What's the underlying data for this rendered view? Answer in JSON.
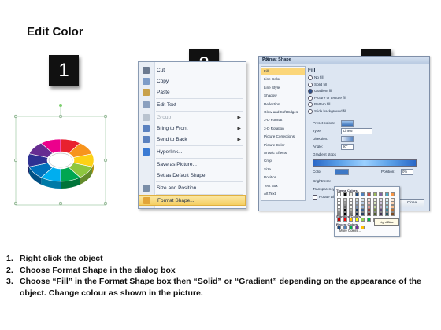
{
  "page": {
    "title": "Edit Color"
  },
  "badges": [
    "1",
    "2",
    "3"
  ],
  "context_menu": {
    "items": [
      {
        "label": "Cut",
        "icon": "scissors-icon",
        "color": "#6b7a90"
      },
      {
        "label": "Copy",
        "icon": "copy-icon",
        "color": "#7d9cc8"
      },
      {
        "label": "Paste",
        "icon": "paste-icon",
        "color": "#c8a14a"
      },
      {
        "label": "Edit Text",
        "icon": "edit-text-icon",
        "color": "#8aa0bf"
      },
      {
        "label": "Group",
        "icon": "group-icon",
        "color": "#b9c3cf",
        "disabled": true,
        "submenu": true
      },
      {
        "label": "Bring to Front",
        "icon": "bring-front-icon",
        "color": "#5b82c0",
        "submenu": true
      },
      {
        "label": "Send to Back",
        "icon": "send-back-icon",
        "color": "#5b82c0",
        "submenu": true
      },
      {
        "label": "Hyperlink...",
        "icon": "hyperlink-icon",
        "color": "#3b7bd4"
      },
      {
        "label": "Save as Picture...",
        "icon": "",
        "color": ""
      },
      {
        "label": "Set as Default Shape",
        "icon": "",
        "color": ""
      },
      {
        "label": "Size and Position...",
        "icon": "size-position-icon",
        "color": "#7a8ea8"
      },
      {
        "label": "Format Shape...",
        "icon": "format-shape-icon",
        "color": "#e2a53a",
        "selected": true
      }
    ]
  },
  "dialog": {
    "title": "Format Shape",
    "help": "? X",
    "sidebar": [
      "Fill",
      "Line Color",
      "Line Style",
      "Shadow",
      "Reflection",
      "Glow and Soft Edges",
      "3-D Format",
      "3-D Rotation",
      "Picture Corrections",
      "Picture Color",
      "Artistic Effects",
      "Crop",
      "Size",
      "Position",
      "Text Box",
      "Alt Text"
    ],
    "fill_heading": "Fill",
    "fill_options": [
      {
        "label": "No fill",
        "on": false
      },
      {
        "label": "Solid fill",
        "on": false
      },
      {
        "label": "Gradient fill",
        "on": true
      },
      {
        "label": "Picture or texture fill",
        "on": false
      },
      {
        "label": "Pattern fill",
        "on": false
      },
      {
        "label": "Slide background fill",
        "on": false
      }
    ],
    "fields": {
      "preset_label": "Preset colors:",
      "type_label": "Type:",
      "type_value": "Linear",
      "direction_label": "Direction:",
      "angle_label": "Angle:",
      "angle_value": "90°",
      "stops_label": "Gradient stops",
      "color_label": "Color",
      "position_label": "Position:",
      "position_value": "0%",
      "brightness_label": "Brightness:",
      "transparency_label": "Transparency:",
      "rotate_label": "Rotate with shape"
    },
    "close_label": "Close"
  },
  "picker": {
    "theme_label": "Theme Colors",
    "standard_label": "Standard Colors",
    "recent_label": "Recent Colors",
    "more_label": "More Colors...",
    "tooltip": "Light Blue",
    "theme_top": [
      "#ffffff",
      "#000000",
      "#eeece1",
      "#1f497d",
      "#4f81bd",
      "#c0504d",
      "#9bbb59",
      "#8064a2",
      "#4bacc6",
      "#f79646"
    ],
    "standard": [
      "#c00000",
      "#ff0000",
      "#ffc000",
      "#ffff00",
      "#92d050",
      "#00b050",
      "#00b0f0",
      "#0070c0",
      "#002060",
      "#7030a0"
    ],
    "recent": [
      "#1f497d",
      "#4f81bd",
      "#00b050",
      "#7030a0",
      "#ffc000"
    ]
  },
  "ring": {
    "colors": [
      "#e8212e",
      "#f7941d",
      "#fcd116",
      "#8dc63f",
      "#00a651",
      "#00aeef",
      "#0072bc",
      "#2e3192",
      "#662d91",
      "#ec008c"
    ]
  },
  "steps": [
    {
      "num": "1.",
      "text": "Right click the object"
    },
    {
      "num": "2.",
      "text": "Choose Format Shape in the dialog box"
    },
    {
      "num": "3.",
      "text": "Choose “Fill” in the Format Shape box then “Solid” or “Gradient” depending on the appearance of the object. Change colour as shown in the picture."
    }
  ]
}
